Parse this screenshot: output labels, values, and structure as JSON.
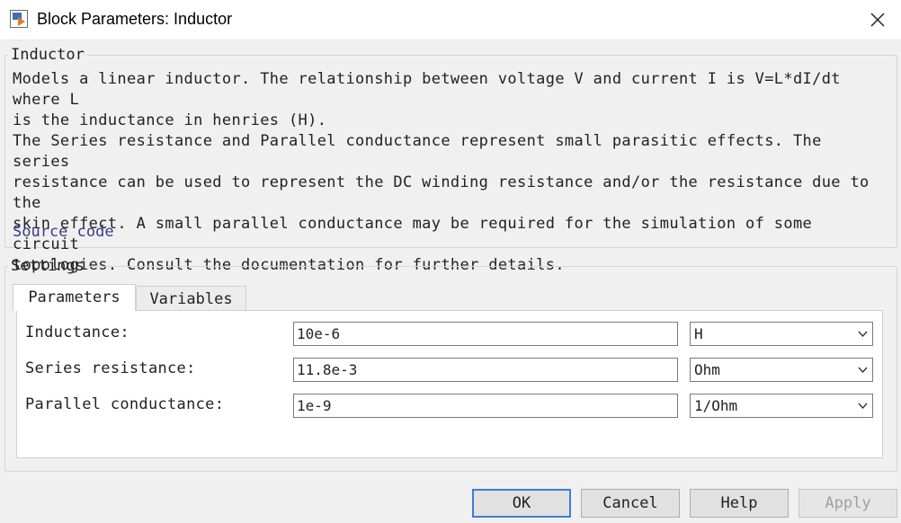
{
  "window": {
    "title": "Block Parameters: Inductor",
    "icons": {
      "app": "simulink-block-icon",
      "close": "close-icon"
    }
  },
  "block": {
    "group_label": "Inductor",
    "description_1": "Models a linear inductor. The relationship between voltage V and current I is V=L*dI/dt where L\nis the inductance in henries (H).",
    "description_2": "The Series resistance and Parallel conductance represent small parasitic effects. The series\nresistance can be used to represent the DC winding resistance and/or the resistance due to the\nskin effect. A small parallel conductance may be required for the simulation of some circuit\ntopologies. Consult the documentation for further details.",
    "source_link": "Source code"
  },
  "settings": {
    "group_label": "Settings",
    "tabs": [
      {
        "label": "Parameters",
        "active": true
      },
      {
        "label": "Variables",
        "active": false
      }
    ],
    "params": [
      {
        "label": "Inductance:",
        "value": "10e-6",
        "unit": "H"
      },
      {
        "label": "Series resistance:",
        "value": "11.8e-3",
        "unit": "Ohm"
      },
      {
        "label": "Parallel conductance:",
        "value": "1e-9",
        "unit": "1/Ohm"
      }
    ]
  },
  "buttons": {
    "ok": "OK",
    "cancel": "Cancel",
    "help": "Help",
    "apply": "Apply"
  },
  "colors": {
    "link": "#3a3a8a",
    "default_button_border": "#3c7fd3",
    "background": "#f0f0f0"
  }
}
